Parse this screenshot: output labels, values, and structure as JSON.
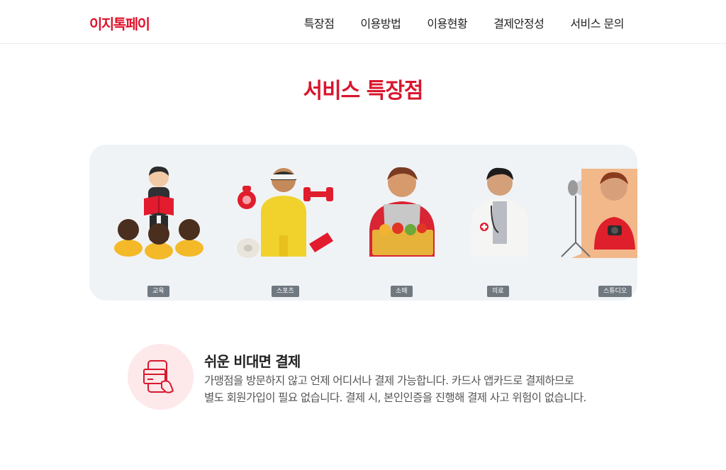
{
  "header": {
    "logo": "이지톡페이",
    "nav": [
      "특장점",
      "이용방법",
      "이용현황",
      "결제안정성",
      "서비스 문의"
    ]
  },
  "section": {
    "title": "서비스 특장점"
  },
  "categories": [
    "교육",
    "스포츠",
    "소매",
    "의료",
    "스튜디오"
  ],
  "feature": {
    "icon": "card-payment-icon",
    "title": "쉬운 비대면 결제",
    "desc_line1": "가맹점을 방문하지 않고 언제 어디서나 결제 가능합니다. 카드사 앱카드로 결제하므로",
    "desc_line2": "별도 회원가입이 필요 없습니다. 결제 시, 본인인증을 진행해 결제 사고 위험이 없습니다."
  },
  "colors": {
    "brand": "#e0142d",
    "panel_bg": "#f0f3f6",
    "tag_bg": "#707880",
    "icon_bg": "#fde8ea"
  }
}
